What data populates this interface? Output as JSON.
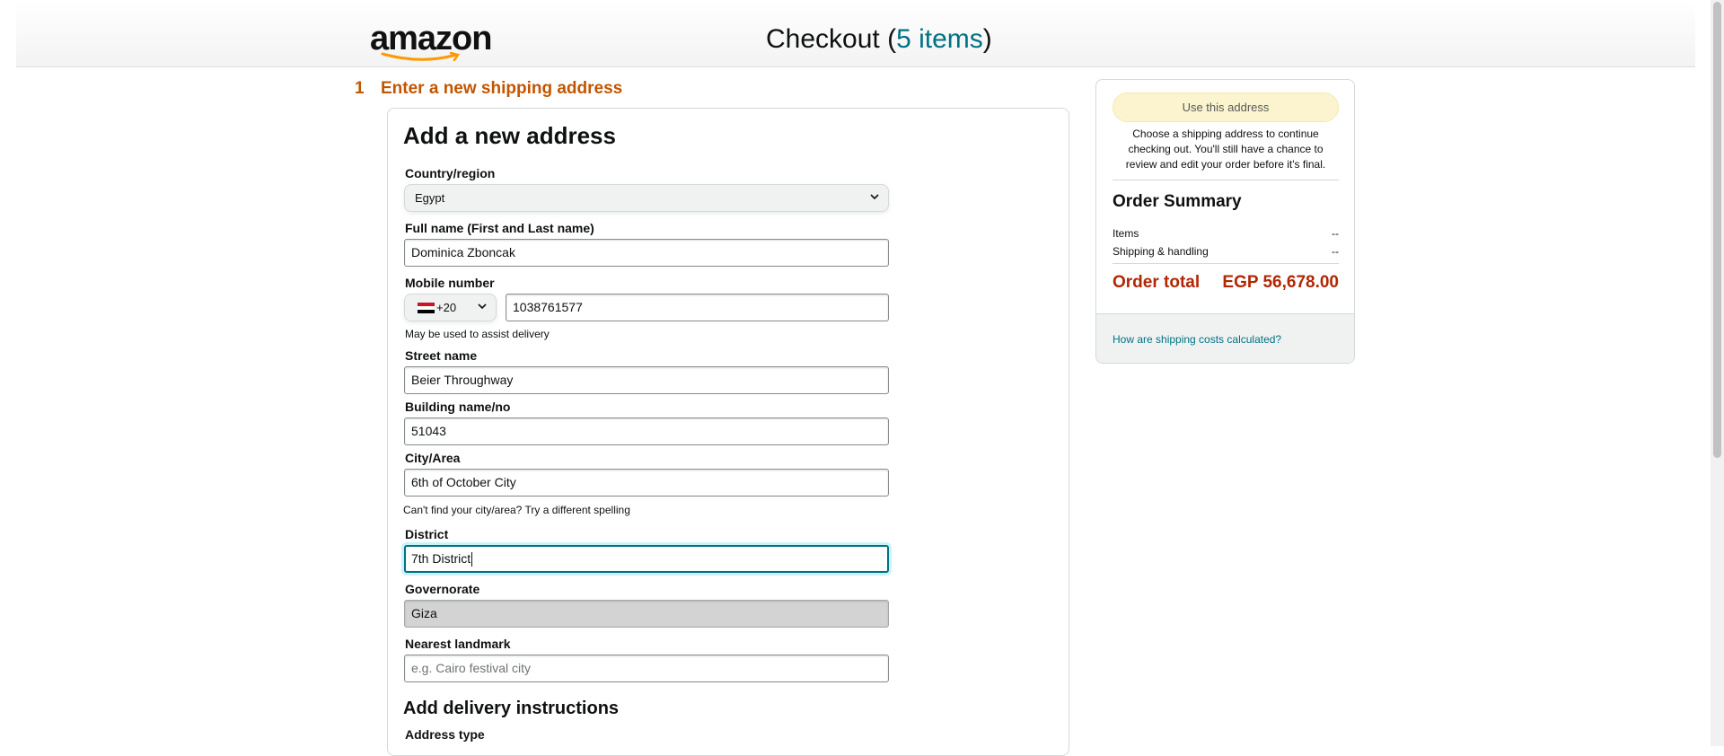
{
  "header": {
    "logo_text": "amazon",
    "title_prefix": "Checkout (",
    "items_link": "5 items",
    "title_suffix": ")"
  },
  "step": {
    "number": "1",
    "label": "Enter a new shipping address"
  },
  "form": {
    "title": "Add a new address",
    "country": {
      "label": "Country/region",
      "value": "Egypt"
    },
    "full_name": {
      "label": "Full name (First and Last name)",
      "value": "Dominica Zboncak"
    },
    "mobile": {
      "label": "Mobile number",
      "country_code": "+20",
      "value": "1038761577",
      "hint": "May be used to assist delivery"
    },
    "street": {
      "label": "Street name",
      "value": "Beier Throughway"
    },
    "building": {
      "label": "Building name/no",
      "value": "51043"
    },
    "city": {
      "label": "City/Area",
      "value": "6th of October City",
      "hint": "Can't find your city/area? Try a different spelling"
    },
    "district": {
      "label": "District",
      "value": "7th District"
    },
    "governorate": {
      "label": "Governorate",
      "value": "Giza"
    },
    "landmark": {
      "label": "Nearest landmark",
      "placeholder": "e.g. Cairo festival city"
    },
    "delivery_section": "Add delivery instructions",
    "address_type_label": "Address type"
  },
  "sidebar": {
    "use_address_button": "Use this address",
    "note": "Choose a shipping address to continue checking out. You'll still have a chance to review and edit your order before it's final.",
    "summary_title": "Order Summary",
    "rows": [
      {
        "label": "Items",
        "value": "--"
      },
      {
        "label": "Shipping & handling",
        "value": "--"
      }
    ],
    "total_label": "Order total",
    "total_value": "EGP 56,678.00",
    "shipping_link": "How are shipping costs calculated?"
  },
  "colors": {
    "step_orange": "#c45500",
    "link_teal": "#007185",
    "total_red": "#b12704",
    "button_yellow": "#fcf4cf",
    "flag_red": "#ce1126",
    "flag_black": "#000000"
  }
}
